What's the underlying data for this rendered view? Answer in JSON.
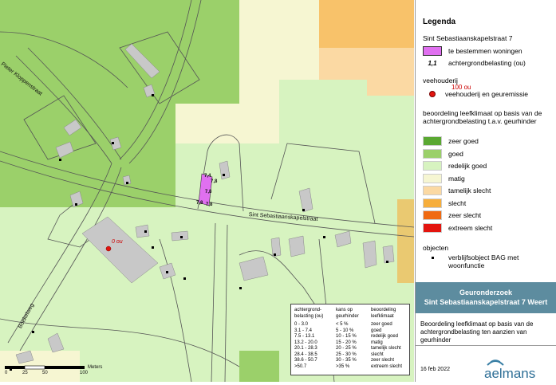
{
  "map": {
    "street_labels": [
      "Pieter Kloppenstraat",
      "Sint Sebastiaanskapelstraat",
      "Boekelweg"
    ],
    "object_labels": [
      "7,4",
      "7,8",
      "7,8",
      "7,8",
      "7,8"
    ],
    "farm_emission_labels": [
      "0 ou"
    ]
  },
  "legend": {
    "title": "Legenda",
    "subject": "Sint Sebastiaanskapelstraat 7",
    "items_top": [
      {
        "symbol": "te-bestemmen-woningen",
        "color": "#e070f0",
        "label": "te bestemmen woningen"
      },
      {
        "symbol": "achtergrondbelasting",
        "glyph": "1,1",
        "label": "achtergrondbelasting (ou)"
      }
    ],
    "veehouderij_header": "veehouderij",
    "veehouderij_value": "100 ou",
    "veehouderij_label": "veehouderij  en geuremissie",
    "beoordeling_header": "beoordeling leefklimaat op basis van de achtergrondbelasting t.a.v. geurhinder",
    "classes": [
      {
        "label": "zeer goed",
        "color": "#5aa832"
      },
      {
        "label": "goed",
        "color": "#9bd06a"
      },
      {
        "label": "redelijk goed",
        "color": "#d7f3c0"
      },
      {
        "label": "matig",
        "color": "#f6f6d2"
      },
      {
        "label": "tamelijk slecht",
        "color": "#fbd9a3"
      },
      {
        "label": "slecht",
        "color": "#f6ae3c"
      },
      {
        "label": "zeer slecht",
        "color": "#f06a12"
      },
      {
        "label": "extreem slecht",
        "color": "#e3140e"
      }
    ],
    "objecten_header": "objecten",
    "objecten_label": "verblijfsobject BAG met woonfunctie"
  },
  "info": {
    "line1": "Geuronderzoek",
    "line2": "Sint Sebastiaanskapelstraat 7 Weert",
    "description": "Beoordeling leefklimaat op basis van de achtergrondbelasting ten aanzien van geurhinder",
    "date": "16 feb 2022",
    "logo_text": "aelmans"
  },
  "table": {
    "headers": [
      "achtergrond-belasting (ou)",
      "kans op geurhinder",
      "beoordeling leefklimaat"
    ],
    "rows": [
      [
        "0 - 3.0",
        "< 5 %",
        "zeer goed"
      ],
      [
        "3.1 - 7.4",
        "5 - 10 %",
        "goed"
      ],
      [
        "7.5 - 13.1",
        "10 - 15 %",
        "redelijk goed"
      ],
      [
        "13.2 - 20.0",
        "15 - 20 %",
        "matig"
      ],
      [
        "20.1 - 28.3",
        "20 - 25 %",
        "tamelijk slecht"
      ],
      [
        "28.4 - 38.5",
        "25 - 30 %",
        "slecht"
      ],
      [
        "38.6 - 50.7",
        "30 - 35 %",
        "zeer slecht"
      ],
      [
        ">50.7",
        ">35  %",
        "extreem slecht"
      ]
    ]
  },
  "scale": {
    "ticks": [
      "0",
      "25",
      "50",
      "100"
    ],
    "unit": "Meters"
  }
}
